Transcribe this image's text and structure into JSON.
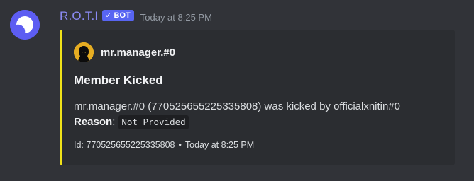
{
  "message": {
    "username": "R.O.T.I",
    "bot_tag": {
      "check": "✓",
      "label": "BOT"
    },
    "timestamp": "Today at 8:25 PM",
    "avatar_icon": "crescent-moon-logo"
  },
  "embed": {
    "accent_color": "#f0e219",
    "author": {
      "name": "mr.manager.#0",
      "icon": "hooded-figure-avatar"
    },
    "title": "Member Kicked",
    "description": "mr.manager.#0 (770525655225335808) was kicked by officialxnitin#0",
    "reason_label": "Reason",
    "reason_colon": ":",
    "reason_value": "Not Provided",
    "footer": {
      "id_text": "Id: 770525655225335808",
      "separator": "•",
      "timestamp": "Today at 8:25 PM"
    }
  },
  "colors": {
    "background": "#313338",
    "embed_background": "#2b2d31",
    "username": "#8b8bf5",
    "bot_tag": "#5865f2"
  }
}
